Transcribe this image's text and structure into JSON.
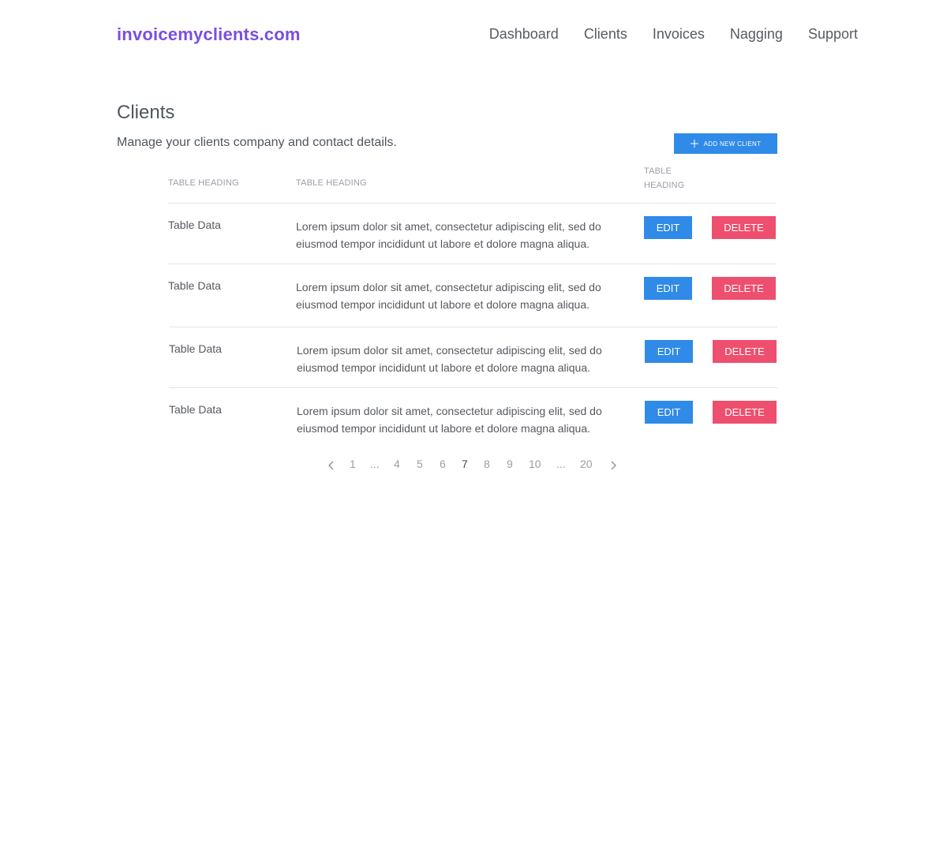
{
  "header": {
    "logo": "invoicemyclients.com",
    "nav": [
      "Dashboard",
      "Clients",
      "Invoices",
      "Nagging",
      "Support"
    ]
  },
  "page": {
    "title": "Clients",
    "subtitle": "Manage your clients company and contact details.",
    "add_button": "ADD NEW CLIENT"
  },
  "table": {
    "headings": [
      "TABLE HEADING",
      "TABLE HEADING",
      "TABLE HEADING"
    ],
    "rows": [
      {
        "name": "Table Data",
        "desc": "Lorem ipsum dolor sit amet, consectetur adipiscing elit, sed do eiusmod tempor incididunt ut labore et dolore magna aliqua.",
        "edit": "EDIT",
        "delete": "DELETE"
      },
      {
        "name": "Table Data",
        "desc": "Lorem ipsum dolor sit amet, consectetur adipiscing elit, sed do eiusmod tempor incididunt ut labore et dolore magna aliqua.",
        "edit": "EDIT",
        "delete": "DELETE"
      },
      {
        "name": "Table Data",
        "desc": "Lorem ipsum dolor sit amet, consectetur adipiscing elit, sed do eiusmod tempor incididunt ut labore et dolore magna aliqua.",
        "edit": "EDIT",
        "delete": "DELETE"
      },
      {
        "name": "Table Data",
        "desc": "Lorem ipsum dolor sit amet, consectetur adipiscing elit, sed do eiusmod tempor incididunt ut labore et dolore magna aliqua.",
        "edit": "EDIT",
        "delete": "DELETE"
      }
    ]
  },
  "pagination": {
    "pages": [
      "1",
      "...",
      "4",
      "5",
      "6",
      "7",
      "8",
      "9",
      "10",
      "...",
      "20"
    ],
    "current": "7",
    "prev_icon": "chevron-left-icon",
    "next_icon": "chevron-right-icon"
  },
  "colors": {
    "brand": "#7b4ee0",
    "primary": "#2f8ae8",
    "danger": "#ef4f6e"
  }
}
